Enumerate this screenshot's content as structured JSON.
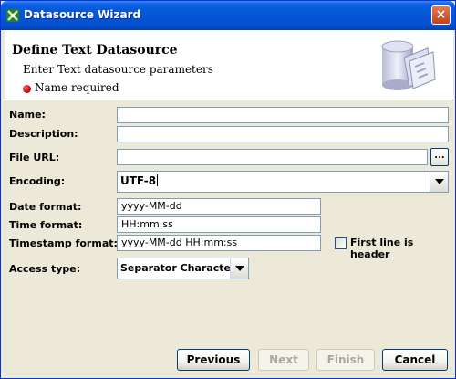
{
  "window": {
    "title": "Datasource Wizard",
    "close_glyph": "×"
  },
  "header": {
    "title": "Define Text Datasource",
    "subtitle": "Enter Text datasource parameters",
    "required_msg": "Name required"
  },
  "form": {
    "name_label": "Name:",
    "name_value": "",
    "description_label": "Description:",
    "description_value": "",
    "file_url_label": "File URL:",
    "file_url_value": "",
    "browse_label": "...",
    "encoding_label": "Encoding:",
    "encoding_value": "UTF-8",
    "date_format_label": "Date format:",
    "date_format_value": "yyyy-MM-dd",
    "time_format_label": "Time format:",
    "time_format_value": "HH:mm:ss",
    "timestamp_format_label": "Timestamp format:",
    "timestamp_format_value": "yyyy-MM-dd HH:mm:ss",
    "first_line_header_label": "First line is header",
    "first_line_header_checked": false,
    "access_type_label": "Access type:",
    "access_type_value": "Separator Character"
  },
  "buttons": {
    "previous": "Previous",
    "next": "Next",
    "finish": "Finish",
    "cancel": "Cancel"
  },
  "colors": {
    "titlebar": "#0458d6",
    "required_dot": "#c00000",
    "face": "#ece9d8"
  },
  "icons": {
    "app": "wizard-app-icon",
    "header": "database-files-icon",
    "close": "close-icon"
  }
}
